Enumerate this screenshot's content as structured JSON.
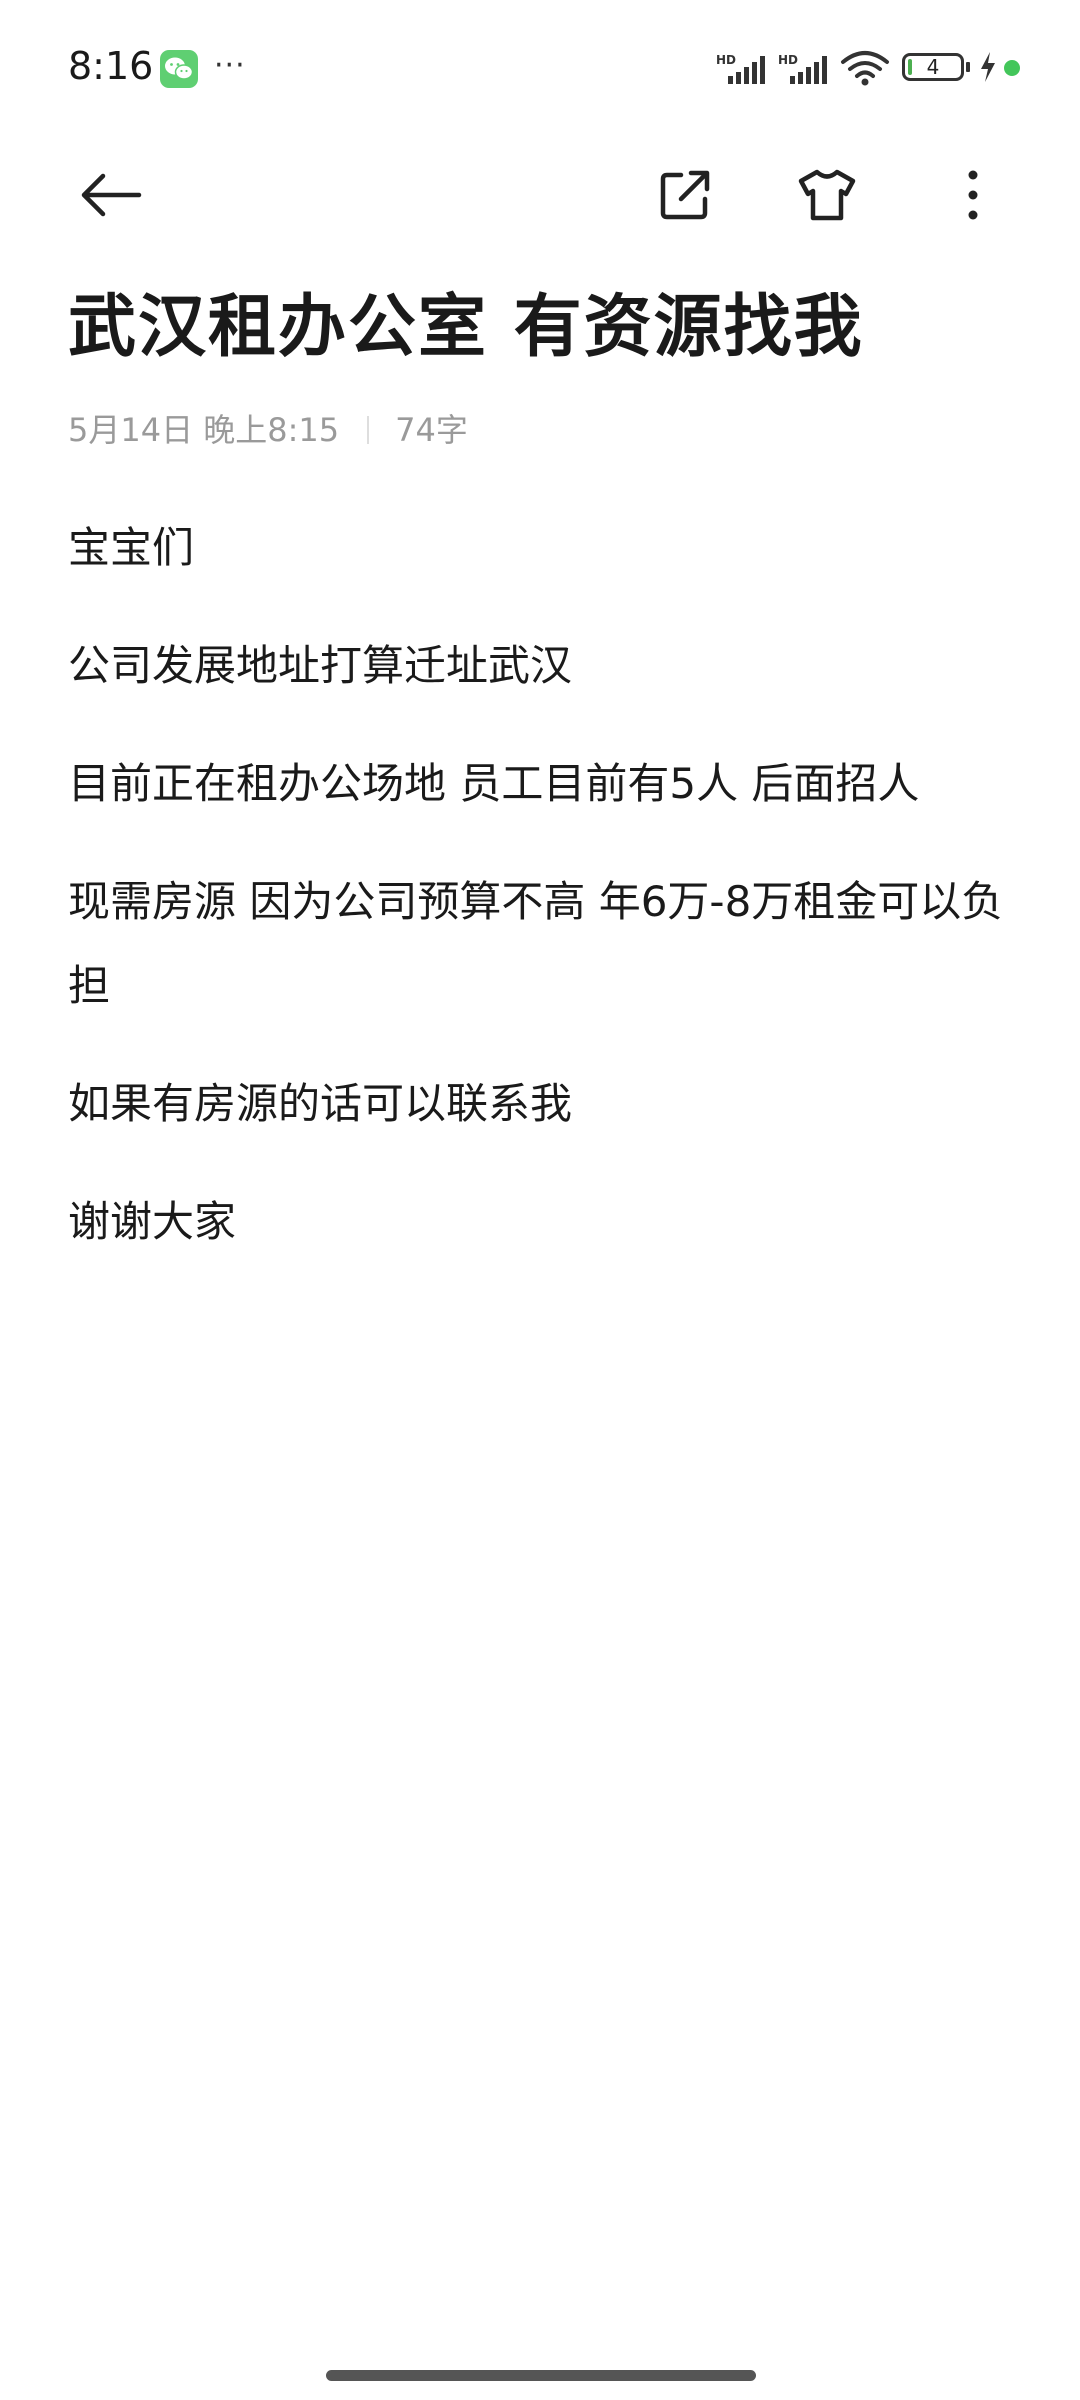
{
  "status_bar": {
    "time": "8:16",
    "more": "···",
    "network_1": "HD",
    "network_2": "HD",
    "battery_level": "4"
  },
  "toolbar": {
    "icons": [
      "back-arrow-icon",
      "share-icon",
      "theme-shirt-icon",
      "more-vertical-icon"
    ]
  },
  "note": {
    "title": "武汉租办公室 有资源找我",
    "date": "5月14日 晚上8:15",
    "char_count": "74字",
    "lines": [
      "宝宝们",
      "公司发展地址打算迁址武汉",
      "目前正在租办公场地 员工目前有5人 后面招人",
      "现需房源 因为公司预算不高 年6万-8万租金可以负担",
      "如果有房源的话可以联系我",
      "谢谢大家"
    ]
  },
  "colors": {
    "accent_green": "#43c65a",
    "wechat_green": "#5fcf72",
    "meta_gray": "#9a9a9a",
    "text": "#1a1a1a"
  }
}
